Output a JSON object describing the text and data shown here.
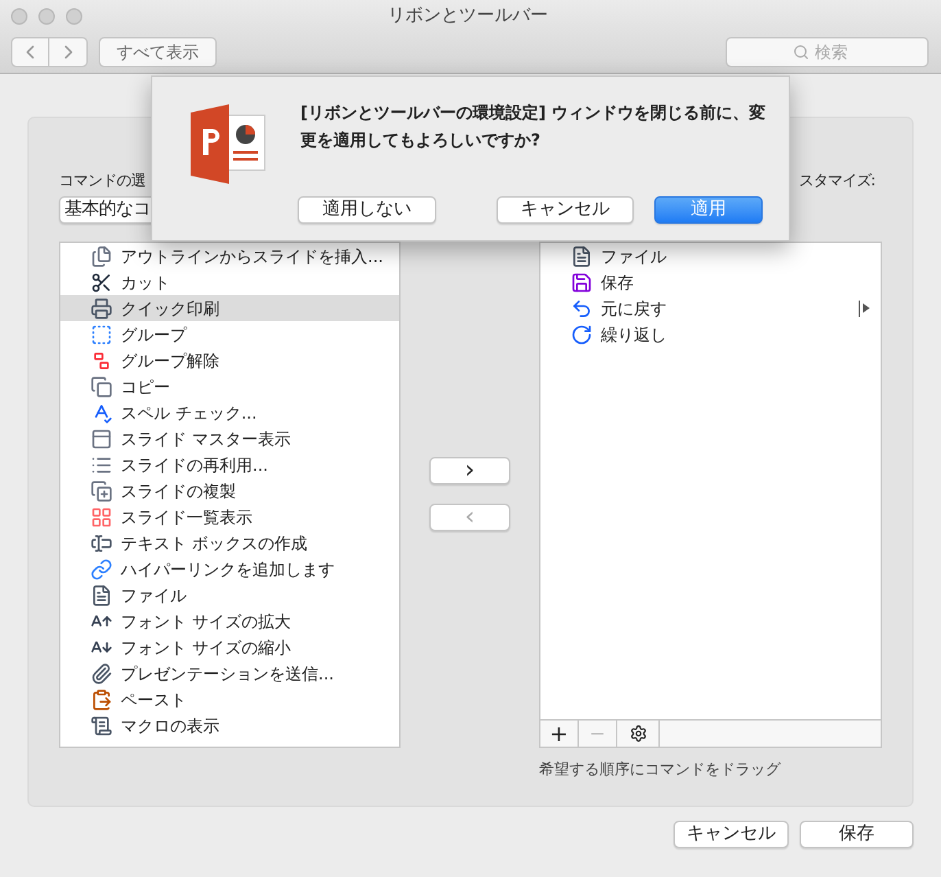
{
  "window": {
    "title": "リボンとツールバー"
  },
  "toolbar": {
    "show_all": "すべて表示",
    "search": {
      "placeholder": "検索"
    }
  },
  "left": {
    "label": "コマンドの選",
    "dropdown": "基本的なコ",
    "items": [
      {
        "label": "アウトラインからスライドを挿入...",
        "selected": false
      },
      {
        "label": "カット",
        "selected": false
      },
      {
        "label": "クイック印刷",
        "selected": true
      },
      {
        "label": "グループ",
        "selected": false
      },
      {
        "label": "グループ解除",
        "selected": false
      },
      {
        "label": "コピー",
        "selected": false
      },
      {
        "label": "スペル チェック...",
        "selected": false
      },
      {
        "label": "スライド マスター表示",
        "selected": false
      },
      {
        "label": "スライドの再利用...",
        "selected": false
      },
      {
        "label": "スライドの複製",
        "selected": false
      },
      {
        "label": "スライド一覧表示",
        "selected": false
      },
      {
        "label": "テキスト ボックスの作成",
        "selected": false
      },
      {
        "label": "ハイパーリンクを追加します",
        "selected": false
      },
      {
        "label": "ファイル",
        "selected": false
      },
      {
        "label": "フォント サイズの拡大",
        "selected": false
      },
      {
        "label": "フォント サイズの縮小",
        "selected": false
      },
      {
        "label": "プレゼンテーションを送信...",
        "selected": false
      },
      {
        "label": "ペースト",
        "selected": false
      },
      {
        "label": "マクロの表示",
        "selected": false
      }
    ]
  },
  "middle": {
    "add": "›",
    "remove": "‹",
    "remove_disabled": true
  },
  "right": {
    "label": "スタマイズ:",
    "items": [
      {
        "label": "ファイル",
        "submenu": false
      },
      {
        "label": "保存",
        "submenu": false
      },
      {
        "label": "元に戻す",
        "submenu": true
      },
      {
        "label": "繰り返し",
        "submenu": false
      }
    ],
    "add": "+",
    "remove": "−",
    "remove_disabled": true,
    "hint": "希望する順序にコマンドをドラッグ"
  },
  "footer": {
    "cancel": "キャンセル",
    "save": "保存"
  },
  "dialog": {
    "message": "[リボンとツールバーの環境設定] ウィンドウを閉じる前に、変更を適用してもよろしいですか?",
    "buttons": [
      {
        "label": "適用しない",
        "default": false
      },
      {
        "label": "キャンセル",
        "default": false
      },
      {
        "label": "適用",
        "default": true
      }
    ]
  }
}
